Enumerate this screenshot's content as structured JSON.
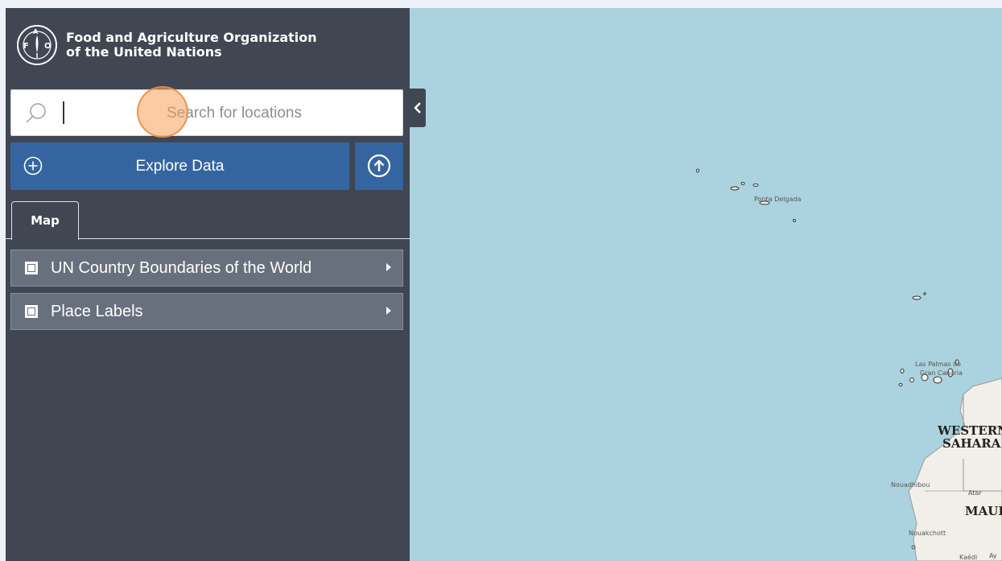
{
  "brand": {
    "line1": "Food and Agriculture Organization",
    "line2": "of the United Nations",
    "logo_letters": "FAO",
    "logo_motto": "FIAT PANIS"
  },
  "search": {
    "placeholder": "Search for locations",
    "value": ""
  },
  "actions": {
    "explore_label": "Explore Data"
  },
  "tabs": [
    {
      "label": "Map"
    }
  ],
  "layers": [
    {
      "label": "UN Country Boundaries of the World",
      "checked": false
    },
    {
      "label": "Place Labels",
      "checked": false
    }
  ],
  "map": {
    "labels": {
      "ponta_delgada": "Ponta Delgada",
      "las_palmas_1": "Las Palmas de",
      "las_palmas_2": "Gran Canaria",
      "western_sahara_1": "WESTERN",
      "western_sahara_2": "SAHARA",
      "nouadhibou": "Nouadhibou",
      "atar": "Atar",
      "mauritania": "MAURITANIA",
      "nouakchott": "Nouakchott",
      "kaedi": "Kaédi",
      "ay": "Ay"
    },
    "colors": {
      "ocean": "#aad3df",
      "land": "#f2efe9",
      "sidebar": "#404652",
      "accent": "#3565a1"
    }
  },
  "icons": {
    "search": "search-icon",
    "plus": "plus-circle-icon",
    "upload": "upload-circle-icon",
    "collapse": "chevron-left-icon",
    "expand": "chevron-right-icon"
  }
}
